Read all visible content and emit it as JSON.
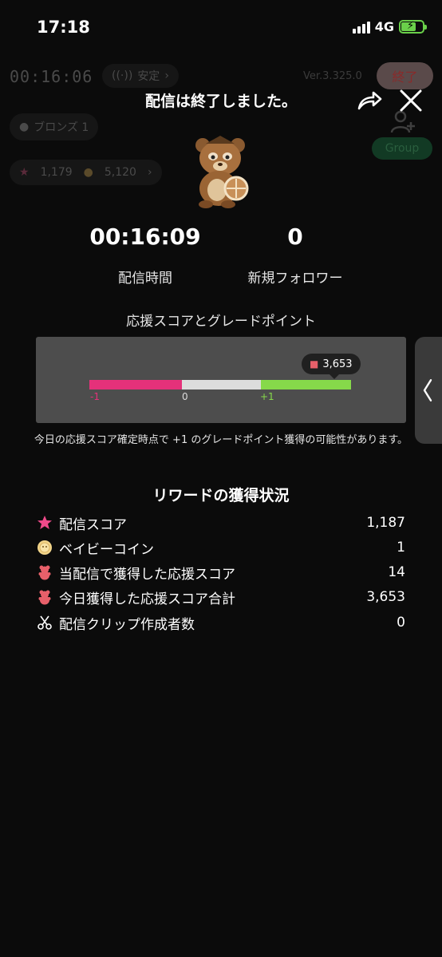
{
  "status_bar": {
    "time": "17:18",
    "network": "4G"
  },
  "background": {
    "timer": "00:16:06",
    "stability": "安定",
    "version": "Ver.3.325.0",
    "end_button": "終了",
    "rank": "ブロンズ 1",
    "group_button": "Group",
    "stars": "1,179",
    "coins": "5,120"
  },
  "header": {
    "title": "配信は終了しました。"
  },
  "stats": {
    "duration_value": "00:16:09",
    "duration_label": "配信時間",
    "followers_value": "0",
    "followers_label": "新規フォロワー"
  },
  "score_section": {
    "label": "応援スコアとグレードポイント",
    "bubble_value": "3,653",
    "tick_neg": "-1",
    "tick_zero": "0",
    "tick_pos": "+1",
    "note": "今日の応援スコア確定時点で +1 のグレードポイント獲得の可能性があります。"
  },
  "rewards": {
    "title": "リワードの獲得状況",
    "items": [
      {
        "icon": "star-icon",
        "label": "配信スコア",
        "value": "1,187"
      },
      {
        "icon": "baby-coin-icon",
        "label": "ベイビーコイン",
        "value": "1"
      },
      {
        "icon": "gummy-bear-icon",
        "label": "当配信で獲得した応援スコア",
        "value": "14"
      },
      {
        "icon": "gummy-bear-icon",
        "label": "今日獲得した応援スコア合計",
        "value": "3,653"
      },
      {
        "icon": "scissors-icon",
        "label": "配信クリップ作成者数",
        "value": "0"
      }
    ]
  },
  "colors": {
    "negative": "#e5317a",
    "neutral": "#dcdcdc",
    "positive": "#86d94a",
    "panel": "#4d4d4d"
  }
}
